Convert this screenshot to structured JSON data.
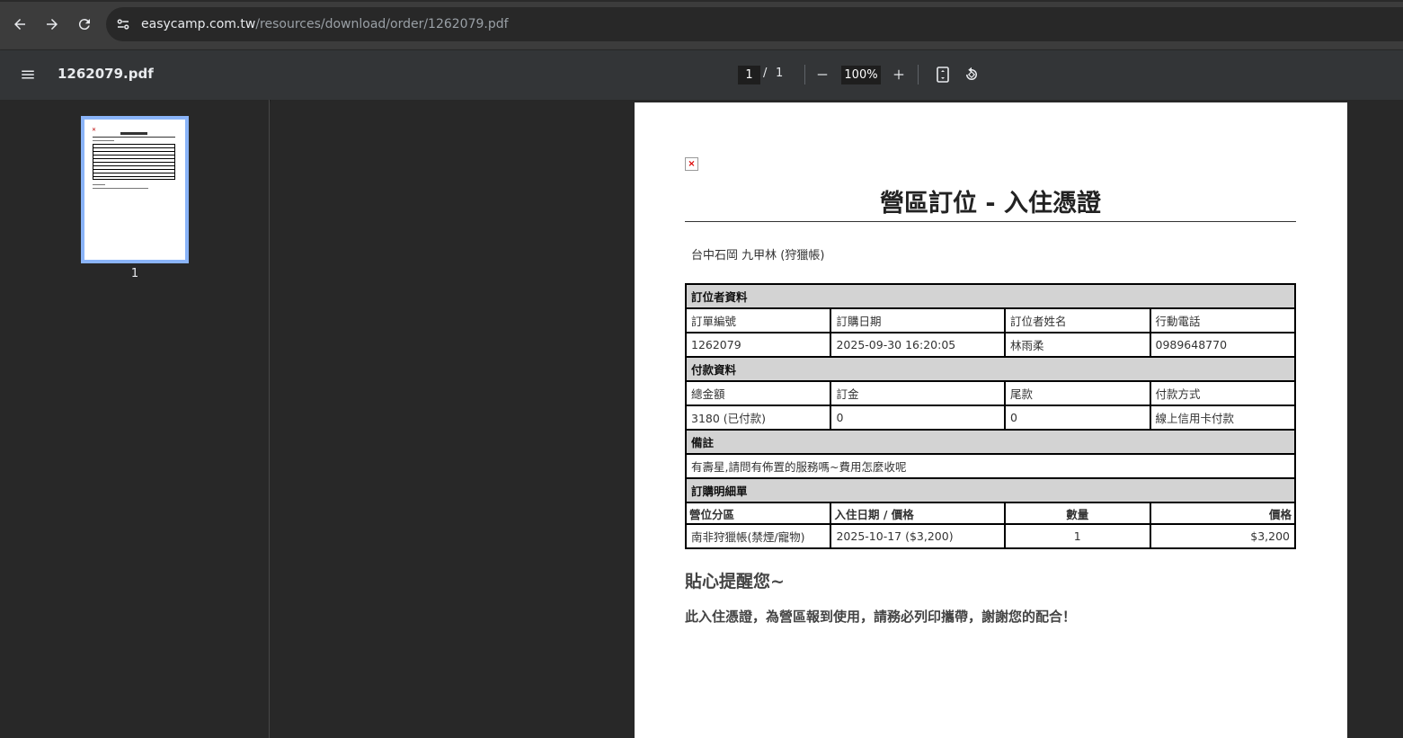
{
  "browser": {
    "url_host": "easycamp.com.tw",
    "url_path": "/resources/download/order/1262079.pdf"
  },
  "pdf_toolbar": {
    "filename": "1262079.pdf",
    "current_page": "1",
    "page_separator": "/",
    "total_pages": "1",
    "zoom": "100%"
  },
  "sidebar": {
    "thumbnail_label": "1"
  },
  "document": {
    "title": "營區訂位 - 入住憑證",
    "campsite": "台中石岡 九甲林 (狩獵帳)",
    "booker_section": "訂位者資料",
    "booker_headers": [
      "訂單編號",
      "訂購日期",
      "訂位者姓名",
      "行動電話"
    ],
    "booker_values": [
      "1262079",
      "2025-09-30 16:20:05",
      "林雨柔",
      "0989648770"
    ],
    "payment_section": "付款資料",
    "payment_headers": [
      "總金額",
      "訂金",
      "尾款",
      "付款方式"
    ],
    "payment_values": [
      "3180 (已付款)",
      "0",
      "0",
      "線上信用卡付款"
    ],
    "notes_section": "備註",
    "notes_value": "有壽星,請問有佈置的服務嗎~費用怎麼收呢",
    "detail_section": "訂購明細單",
    "detail_headers": [
      "營位分區",
      "入住日期 / 價格",
      "數量",
      "價格"
    ],
    "detail_values": [
      "南非狩獵帳(禁煙/寵物)",
      "2025-10-17 ($3,200)",
      "1",
      "$3,200"
    ],
    "reminder_title": "貼心提醒您~",
    "reminder_text": "此入住憑證，為營區報到使用，請務必列印攜帶，謝謝您的配合！"
  }
}
